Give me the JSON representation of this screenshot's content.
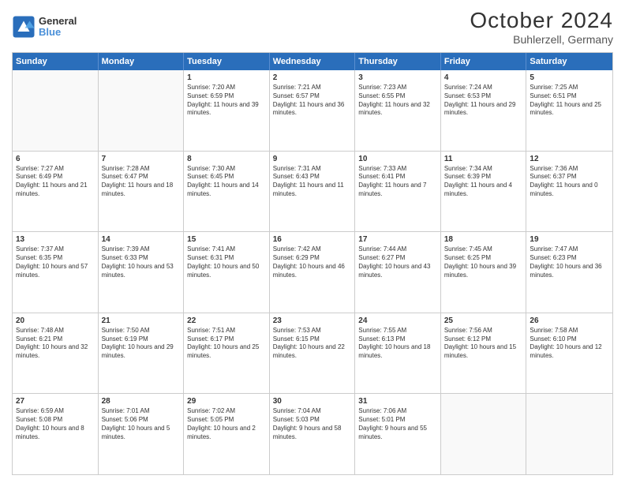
{
  "header": {
    "logo": {
      "line1": "General",
      "line2": "Blue"
    },
    "title": "October 2024",
    "subtitle": "Buhlerzell, Germany"
  },
  "days": [
    "Sunday",
    "Monday",
    "Tuesday",
    "Wednesday",
    "Thursday",
    "Friday",
    "Saturday"
  ],
  "weeks": [
    [
      {
        "day": "",
        "text": ""
      },
      {
        "day": "",
        "text": ""
      },
      {
        "day": "1",
        "text": "Sunrise: 7:20 AM\nSunset: 6:59 PM\nDaylight: 11 hours and 39 minutes."
      },
      {
        "day": "2",
        "text": "Sunrise: 7:21 AM\nSunset: 6:57 PM\nDaylight: 11 hours and 36 minutes."
      },
      {
        "day": "3",
        "text": "Sunrise: 7:23 AM\nSunset: 6:55 PM\nDaylight: 11 hours and 32 minutes."
      },
      {
        "day": "4",
        "text": "Sunrise: 7:24 AM\nSunset: 6:53 PM\nDaylight: 11 hours and 29 minutes."
      },
      {
        "day": "5",
        "text": "Sunrise: 7:25 AM\nSunset: 6:51 PM\nDaylight: 11 hours and 25 minutes."
      }
    ],
    [
      {
        "day": "6",
        "text": "Sunrise: 7:27 AM\nSunset: 6:49 PM\nDaylight: 11 hours and 21 minutes."
      },
      {
        "day": "7",
        "text": "Sunrise: 7:28 AM\nSunset: 6:47 PM\nDaylight: 11 hours and 18 minutes."
      },
      {
        "day": "8",
        "text": "Sunrise: 7:30 AM\nSunset: 6:45 PM\nDaylight: 11 hours and 14 minutes."
      },
      {
        "day": "9",
        "text": "Sunrise: 7:31 AM\nSunset: 6:43 PM\nDaylight: 11 hours and 11 minutes."
      },
      {
        "day": "10",
        "text": "Sunrise: 7:33 AM\nSunset: 6:41 PM\nDaylight: 11 hours and 7 minutes."
      },
      {
        "day": "11",
        "text": "Sunrise: 7:34 AM\nSunset: 6:39 PM\nDaylight: 11 hours and 4 minutes."
      },
      {
        "day": "12",
        "text": "Sunrise: 7:36 AM\nSunset: 6:37 PM\nDaylight: 11 hours and 0 minutes."
      }
    ],
    [
      {
        "day": "13",
        "text": "Sunrise: 7:37 AM\nSunset: 6:35 PM\nDaylight: 10 hours and 57 minutes."
      },
      {
        "day": "14",
        "text": "Sunrise: 7:39 AM\nSunset: 6:33 PM\nDaylight: 10 hours and 53 minutes."
      },
      {
        "day": "15",
        "text": "Sunrise: 7:41 AM\nSunset: 6:31 PM\nDaylight: 10 hours and 50 minutes."
      },
      {
        "day": "16",
        "text": "Sunrise: 7:42 AM\nSunset: 6:29 PM\nDaylight: 10 hours and 46 minutes."
      },
      {
        "day": "17",
        "text": "Sunrise: 7:44 AM\nSunset: 6:27 PM\nDaylight: 10 hours and 43 minutes."
      },
      {
        "day": "18",
        "text": "Sunrise: 7:45 AM\nSunset: 6:25 PM\nDaylight: 10 hours and 39 minutes."
      },
      {
        "day": "19",
        "text": "Sunrise: 7:47 AM\nSunset: 6:23 PM\nDaylight: 10 hours and 36 minutes."
      }
    ],
    [
      {
        "day": "20",
        "text": "Sunrise: 7:48 AM\nSunset: 6:21 PM\nDaylight: 10 hours and 32 minutes."
      },
      {
        "day": "21",
        "text": "Sunrise: 7:50 AM\nSunset: 6:19 PM\nDaylight: 10 hours and 29 minutes."
      },
      {
        "day": "22",
        "text": "Sunrise: 7:51 AM\nSunset: 6:17 PM\nDaylight: 10 hours and 25 minutes."
      },
      {
        "day": "23",
        "text": "Sunrise: 7:53 AM\nSunset: 6:15 PM\nDaylight: 10 hours and 22 minutes."
      },
      {
        "day": "24",
        "text": "Sunrise: 7:55 AM\nSunset: 6:13 PM\nDaylight: 10 hours and 18 minutes."
      },
      {
        "day": "25",
        "text": "Sunrise: 7:56 AM\nSunset: 6:12 PM\nDaylight: 10 hours and 15 minutes."
      },
      {
        "day": "26",
        "text": "Sunrise: 7:58 AM\nSunset: 6:10 PM\nDaylight: 10 hours and 12 minutes."
      }
    ],
    [
      {
        "day": "27",
        "text": "Sunrise: 6:59 AM\nSunset: 5:08 PM\nDaylight: 10 hours and 8 minutes."
      },
      {
        "day": "28",
        "text": "Sunrise: 7:01 AM\nSunset: 5:06 PM\nDaylight: 10 hours and 5 minutes."
      },
      {
        "day": "29",
        "text": "Sunrise: 7:02 AM\nSunset: 5:05 PM\nDaylight: 10 hours and 2 minutes."
      },
      {
        "day": "30",
        "text": "Sunrise: 7:04 AM\nSunset: 5:03 PM\nDaylight: 9 hours and 58 minutes."
      },
      {
        "day": "31",
        "text": "Sunrise: 7:06 AM\nSunset: 5:01 PM\nDaylight: 9 hours and 55 minutes."
      },
      {
        "day": "",
        "text": ""
      },
      {
        "day": "",
        "text": ""
      }
    ]
  ]
}
